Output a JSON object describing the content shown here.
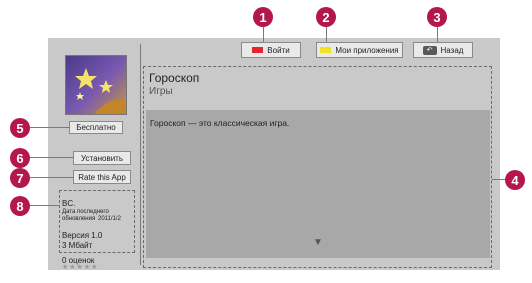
{
  "toolbar": {
    "login_label": "Войти",
    "login_color": "#e0262e",
    "apps_label": "Мои приложения",
    "apps_color": "#f1e21f",
    "back_label": "Назад",
    "back_icon": "back-key-icon"
  },
  "app": {
    "title": "Гороскоп",
    "category": "Игры",
    "description": "Гороскоп — это классическая игра.",
    "price_label": "Бесплатно",
    "install_label": "Установить",
    "rate_label": "Rate this App",
    "icon": "horoscope-stars-icon"
  },
  "info": {
    "developer": "BC.",
    "date_label_line1": "Дата последнего",
    "date_label_line2": "обновления",
    "date_value": "2011/1/2",
    "version": "Версия 1.0",
    "size": "3 Мбайт",
    "ratings": "0 оценок",
    "stars": "★★★★★",
    "rating_value": 0,
    "rating_max": 5
  },
  "scroll_arrow": "▼",
  "markers": {
    "m1": "1",
    "m2": "2",
    "m3": "3",
    "m4": "4",
    "m5": "5",
    "m6": "6",
    "m7": "7",
    "m8": "8"
  },
  "colors": {
    "marker": "#b4174d",
    "screen": "#c9c9c9",
    "description_bg": "#a8a8a8"
  }
}
